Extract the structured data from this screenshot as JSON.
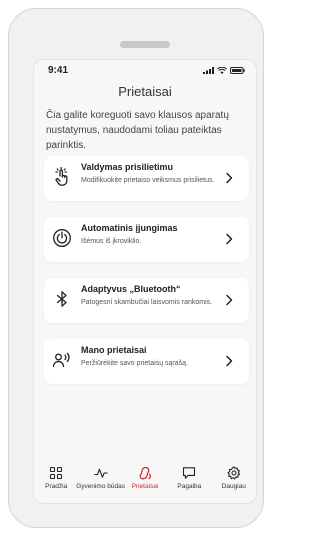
{
  "status": {
    "time": "9:41"
  },
  "header": {
    "title": "Prietaisai"
  },
  "intro": "Čia galite koreguoti savo klausos aparatų nustatymus, naudodami toliau pateiktas parinktis.",
  "cards": [
    {
      "title": "Valdymas prisilietimu",
      "subtitle": "Modifikuokite prietaiso veiksmus prisilietus.",
      "icon": "touch-hand-icon"
    },
    {
      "title": "Automatinis įjungimas",
      "subtitle": "Išėmus iš įkroviklio.",
      "icon": "power-icon"
    },
    {
      "title": "Adaptyvus „Bluetooth“",
      "subtitle": "Patogesni skambučiai laisvomis rankomis.",
      "icon": "bluetooth-icon"
    },
    {
      "title": "Mano prietaisai",
      "subtitle": "Peržiūrėkite savo prietaisų sąrašą.",
      "icon": "person-sound-icon"
    }
  ],
  "tabs": [
    {
      "label": "Pradžia",
      "icon": "grid-icon",
      "active": false
    },
    {
      "label": "Gyvenimo būdas",
      "icon": "activity-icon",
      "active": false
    },
    {
      "label": "Prietaisai",
      "icon": "hearing-aid-icon",
      "active": true
    },
    {
      "label": "Pagalba",
      "icon": "chat-bubble-icon",
      "active": false
    },
    {
      "label": "Daugiau",
      "icon": "gear-icon",
      "active": false
    }
  ],
  "colors": {
    "accent": "#d22630",
    "background": "#f7f7f7",
    "card": "#ffffff"
  }
}
